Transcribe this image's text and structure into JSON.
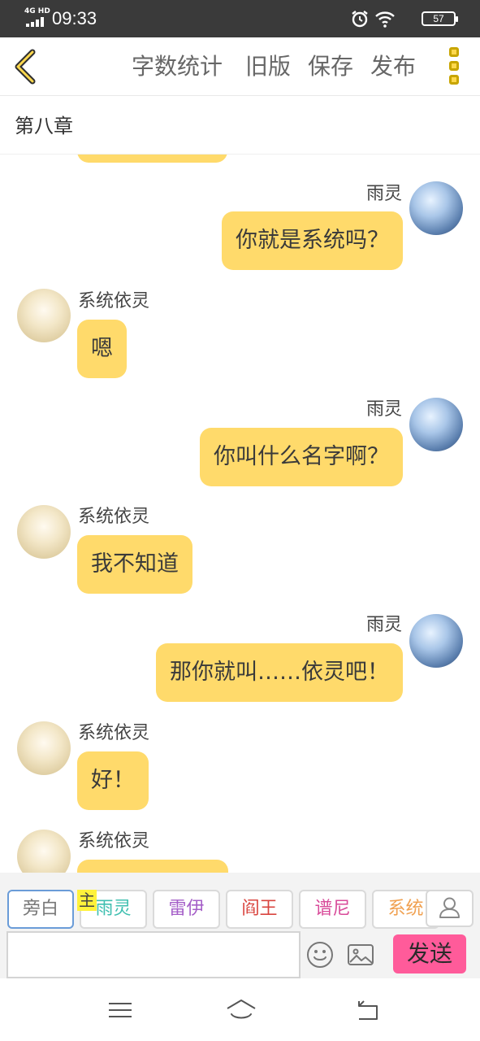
{
  "status_bar": {
    "network": "4G HD",
    "time": "09:33",
    "battery": "57"
  },
  "toolbar": {
    "back_icon": "chevron-left-icon",
    "actions": [
      "字数统计",
      "旧版",
      "保存",
      "发布"
    ],
    "more_icon": "more-vertical-icon",
    "accent_color": "#ffd84d"
  },
  "chapter": {
    "title": "第八章"
  },
  "messages": [
    {
      "side": "right",
      "name": "雨灵",
      "text": "你就是系统吗？"
    },
    {
      "side": "left",
      "name": "系统依灵",
      "text": "嗯"
    },
    {
      "side": "right",
      "name": "雨灵",
      "text": "你叫什么名字啊？"
    },
    {
      "side": "left",
      "name": "系统依灵",
      "text": "我不知道"
    },
    {
      "side": "right",
      "name": "雨灵",
      "text": "那你就叫……依灵吧！"
    },
    {
      "side": "left",
      "name": "系统依灵",
      "text": "好！"
    },
    {
      "side": "left",
      "name": "系统依灵",
      "text": ""
    }
  ],
  "roles": {
    "main_tag": "主",
    "items": [
      {
        "label": "旁白",
        "color": "#777777"
      },
      {
        "label": "雨灵",
        "color": "#3fbfb0"
      },
      {
        "label": "雷伊",
        "color": "#a55fc8"
      },
      {
        "label": "阎王",
        "color": "#d9453f"
      },
      {
        "label": "谱尼",
        "color": "#d84a9a"
      },
      {
        "label": "系统",
        "color": "#f0a050"
      }
    ],
    "add_icon": "user-icon"
  },
  "input": {
    "value": "",
    "emoji_icon": "emoji-icon",
    "image_icon": "image-icon",
    "send_label": "发送",
    "send_color": "#ff5b9a"
  },
  "nav": [
    "menu-icon",
    "home-icon",
    "back-icon"
  ]
}
